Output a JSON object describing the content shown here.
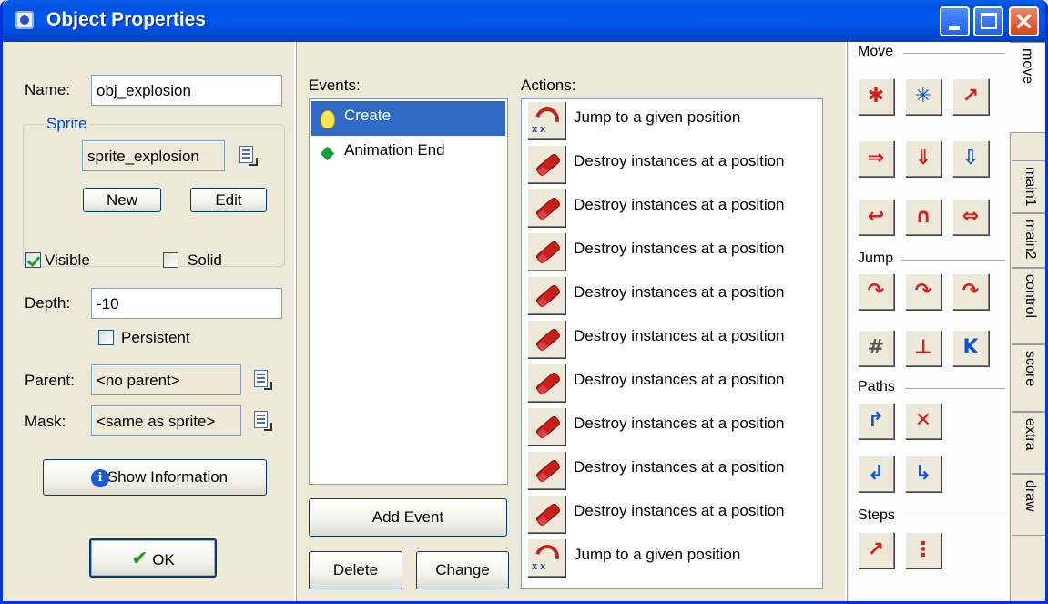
{
  "window": {
    "title": "Object Properties"
  },
  "left": {
    "name_label": "Name:",
    "name_value": "obj_explosion",
    "sprite_group": "Sprite",
    "sprite_value": "sprite_explosion",
    "new_btn": "New",
    "edit_btn": "Edit",
    "visible_label": "Visible",
    "visible_checked": true,
    "solid_label": "Solid",
    "solid_checked": false,
    "depth_label": "Depth:",
    "depth_value": "-10",
    "persistent_label": "Persistent",
    "persistent_checked": false,
    "parent_label": "Parent:",
    "parent_value": "<no parent>",
    "mask_label": "Mask:",
    "mask_value": "<same as sprite>",
    "info_btn": "Show Information",
    "ok_btn": "OK"
  },
  "events": {
    "label": "Events:",
    "items": [
      {
        "label": "Create",
        "icon": "lightbulb-icon",
        "selected": true
      },
      {
        "label": "Animation End",
        "icon": "green-diamond-icon",
        "selected": false
      }
    ],
    "add_btn": "Add Event",
    "delete_btn": "Delete",
    "change_btn": "Change"
  },
  "actions": {
    "label": "Actions:",
    "items": [
      {
        "label": "Jump to a given position",
        "icon": "jump-position-icon"
      },
      {
        "label": "Destroy instances at a position",
        "icon": "destroy-position-icon"
      },
      {
        "label": "Destroy instances at a position",
        "icon": "destroy-position-icon"
      },
      {
        "label": "Destroy instances at a position",
        "icon": "destroy-position-icon"
      },
      {
        "label": "Destroy instances at a position",
        "icon": "destroy-position-icon"
      },
      {
        "label": "Destroy instances at a position",
        "icon": "destroy-position-icon"
      },
      {
        "label": "Destroy instances at a position",
        "icon": "destroy-position-icon"
      },
      {
        "label": "Destroy instances at a position",
        "icon": "destroy-position-icon"
      },
      {
        "label": "Destroy instances at a position",
        "icon": "destroy-position-icon"
      },
      {
        "label": "Destroy instances at a position",
        "icon": "destroy-position-icon"
      },
      {
        "label": "Jump to a given position",
        "icon": "jump-position-icon"
      }
    ]
  },
  "library": {
    "sections": {
      "move": "Move",
      "jump": "Jump",
      "paths": "Paths",
      "steps": "Steps"
    },
    "tabs": [
      "move",
      "main1",
      "main2",
      "control",
      "score",
      "extra",
      "draw"
    ],
    "active_tab": "move"
  }
}
